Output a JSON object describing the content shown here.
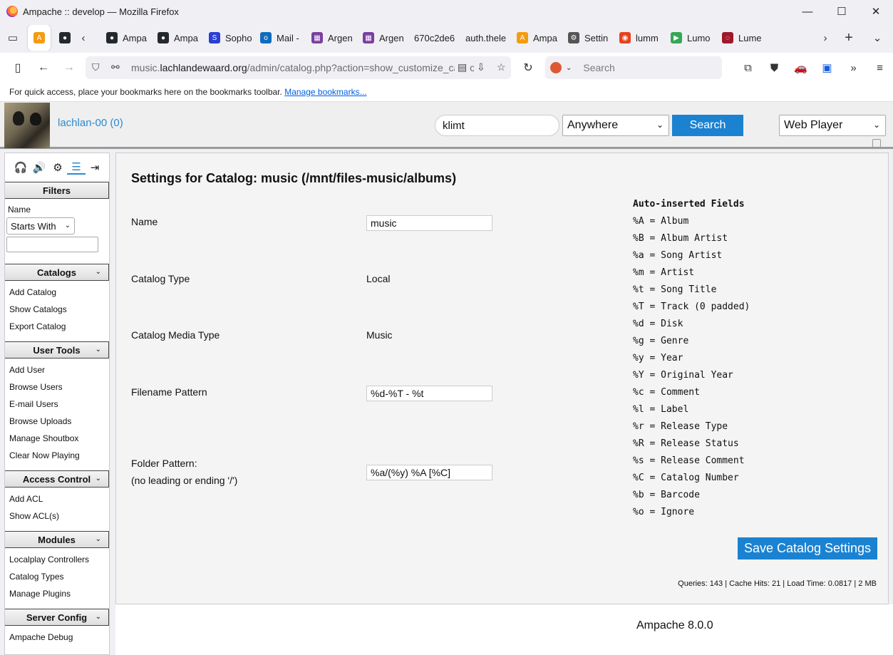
{
  "window": {
    "title": "Ampache :: develop — Mozilla Firefox",
    "minimize": "—",
    "maximize": "☐",
    "close": "✕"
  },
  "tabs": [
    {
      "label": "",
      "icon": "ampache-icon",
      "color": "#f39c12",
      "glyph": "A",
      "active": true
    },
    {
      "label": "",
      "icon": "github-icon",
      "color": "#24292e",
      "glyph": "●"
    },
    {
      "label": "Ampa",
      "icon": "github-icon",
      "color": "#24292e",
      "glyph": "●"
    },
    {
      "label": "Ampa",
      "icon": "github-icon",
      "color": "#24292e",
      "glyph": "●"
    },
    {
      "label": "Sopho",
      "icon": "sophos-icon",
      "color": "#2b3ed6",
      "glyph": "S"
    },
    {
      "label": "Mail -",
      "icon": "outlook-icon",
      "color": "#0f6cbd",
      "glyph": "o"
    },
    {
      "label": "Argen",
      "icon": "argent-icon",
      "color": "#7b3fa0",
      "glyph": "▦"
    },
    {
      "label": "Argen",
      "icon": "argent-icon",
      "color": "#7b3fa0",
      "glyph": "▦"
    },
    {
      "label": "670c2de6",
      "icon": "blank-icon",
      "color": "#ffffff",
      "glyph": ""
    },
    {
      "label": "auth.thele",
      "icon": "blank-icon",
      "color": "#ffffff",
      "glyph": ""
    },
    {
      "label": "Ampa",
      "icon": "ampache-icon",
      "color": "#f39c12",
      "glyph": "A"
    },
    {
      "label": "Settin",
      "icon": "gear-icon",
      "color": "#555555",
      "glyph": "⚙"
    },
    {
      "label": "lumm",
      "icon": "lumm-icon",
      "color": "#e8411b",
      "glyph": "◉"
    },
    {
      "label": "Lumo",
      "icon": "play-icon",
      "color": "#34a853",
      "glyph": "▶"
    },
    {
      "label": "Lume",
      "icon": "lume-icon",
      "color": "#a0182a",
      "glyph": "◌"
    }
  ],
  "nav": {
    "url_prefix": "music.",
    "url_domain": "lachlandewaard.org",
    "url_path": "/admin/catalog.php?action=show_customize_catalog",
    "search_placeholder": "Search"
  },
  "bookmarks": {
    "text": "For quick access, place your bookmarks here on the bookmarks toolbar.",
    "link": "Manage bookmarks..."
  },
  "header": {
    "username": "lachlan-00 (0)",
    "search_value": "klimt",
    "search_scope": "Anywhere",
    "search_button": "Search",
    "player": "Web Player"
  },
  "sidebar": {
    "filters_title": "Filters",
    "name_label": "Name",
    "starts_with": "Starts With",
    "sections": [
      {
        "title": "Catalogs",
        "items": [
          "Add Catalog",
          "Show Catalogs",
          "Export Catalog"
        ]
      },
      {
        "title": "User Tools",
        "items": [
          "Add User",
          "Browse Users",
          "E-mail Users",
          "Browse Uploads",
          "Manage Shoutbox",
          "Clear Now Playing"
        ]
      },
      {
        "title": "Access Control",
        "items": [
          "Add ACL",
          "Show ACL(s)"
        ]
      },
      {
        "title": "Modules",
        "items": [
          "Localplay Controllers",
          "Catalog Types",
          "Manage Plugins"
        ]
      },
      {
        "title": "Server Config",
        "items": [
          "Ampache Debug"
        ]
      }
    ]
  },
  "main": {
    "title": "Settings for Catalog: music (/mnt/files-music/albums)",
    "fields": {
      "name_label": "Name",
      "name_value": "music",
      "type_label": "Catalog Type",
      "type_value": "Local",
      "media_label": "Catalog Media Type",
      "media_value": "Music",
      "filename_label": "Filename Pattern",
      "filename_value": "%d-%T - %t",
      "folder_label": "Folder Pattern:",
      "folder_note": "(no leading or ending '/')",
      "folder_value": "%a/(%y) %A [%C]"
    },
    "auto_title": "Auto-inserted Fields",
    "auto_fields": [
      "%A = Album",
      "%B = Album Artist",
      "%a = Song Artist",
      "%m = Artist",
      "%t = Song Title",
      "%T = Track (0 padded)",
      "%d = Disk",
      "%g = Genre",
      "%y = Year",
      "%Y = Original Year",
      "%c = Comment",
      "%l = Label",
      "%r = Release Type",
      "%R = Release Status",
      "%s = Release Comment",
      "%C = Catalog Number",
      "%b = Barcode",
      "%o = Ignore"
    ],
    "save_button": "Save Catalog Settings",
    "stats": "Queries: 143 | Cache Hits: 21 | Load Time: 0.0817 | 2 MB"
  },
  "footer": {
    "version": "Ampache 8.0.0"
  }
}
